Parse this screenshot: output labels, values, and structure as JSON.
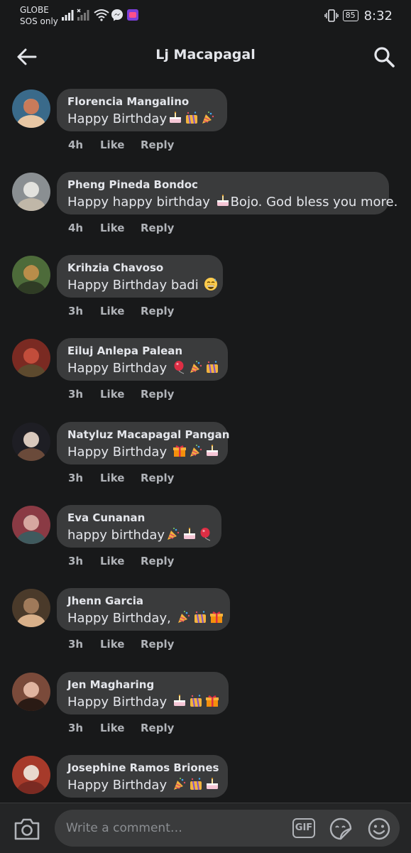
{
  "status": {
    "carrier_line1": "GLOBE",
    "carrier_line2": "SOS only",
    "battery": "85",
    "time": "8:32"
  },
  "header": {
    "title": "Lj Macapagal"
  },
  "comments": [
    {
      "name": "Florencia Mangalino",
      "text": "Happy Birthday",
      "emojis": [
        "cake",
        "confetti",
        "party"
      ],
      "time": "4h",
      "like": "Like",
      "reply": "Reply"
    },
    {
      "name": "Pheng Pineda Bondoc",
      "text_pre": "Happy happy birthday ",
      "text_post": "Bojo. God bless you more.",
      "emojis": [
        "cake"
      ],
      "time": "4h",
      "like": "Like",
      "reply": "Reply"
    },
    {
      "name": "Krihzia Chavoso",
      "text": "Happy Birthday badi ",
      "emojis": [
        "grin-sweat"
      ],
      "time": "3h",
      "like": "Like",
      "reply": "Reply"
    },
    {
      "name": "Eiluj Anlepa Palean",
      "text": "Happy Birthday ",
      "emojis": [
        "balloon",
        "party",
        "confetti"
      ],
      "time": "3h",
      "like": "Like",
      "reply": "Reply"
    },
    {
      "name": "Natyluz Macapagal Pangan",
      "text": "Happy Birthday ",
      "emojis": [
        "gift",
        "party",
        "cake"
      ],
      "time": "3h",
      "like": "Like",
      "reply": "Reply"
    },
    {
      "name": "Eva Cunanan",
      "text": "happy birthday",
      "emojis": [
        "party",
        "cake",
        "balloon"
      ],
      "time": "3h",
      "like": "Like",
      "reply": "Reply"
    },
    {
      "name": "Jhenn Garcia",
      "text": "Happy Birthday, ",
      "emojis": [
        "party",
        "confetti",
        "gift"
      ],
      "time": "3h",
      "like": "Like",
      "reply": "Reply"
    },
    {
      "name": "Jen Magharing",
      "text": "Happy Birthday ",
      "emojis": [
        "cake",
        "confetti",
        "gift"
      ],
      "time": "3h",
      "like": "Like",
      "reply": "Reply"
    },
    {
      "name": "Josephine Ramos Briones",
      "text": "Happy Birthday ",
      "emojis": [
        "party",
        "confetti",
        "cake"
      ],
      "time": "",
      "like": "",
      "reply": ""
    }
  ],
  "composer": {
    "placeholder": "Write a comment…",
    "gif_label": "GIF"
  },
  "colors": {
    "background": "#18191a",
    "bubble": "#3a3b3c",
    "text": "#e4e6eb",
    "secondary": "#b0b3b8"
  }
}
